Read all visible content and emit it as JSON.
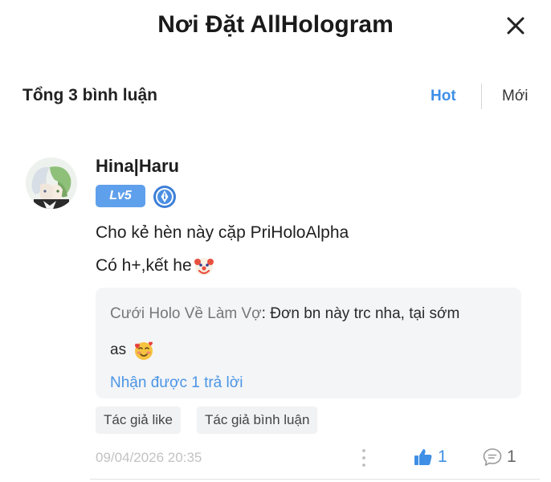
{
  "header": {
    "title": "Nơi Đặt AllHologram",
    "close_icon": "close-icon"
  },
  "comments_bar": {
    "count_label": "Tổng 3 bình luận",
    "sort_hot": "Hot",
    "sort_new": "Mới",
    "active_sort_color": "#3f8fe6"
  },
  "comment": {
    "username": "Hina|Haru",
    "level_badge": "Lv5",
    "level_badge_color": "#5fa0ec",
    "medal_icon": "pen-medal-icon",
    "text_line1": "Cho kẻ hèn này cặp PriHoloAlpha",
    "text_line2": "Có h+,kết he",
    "text_emoji": "clown-face-emoji",
    "reply": {
      "author": "Cưới Holo Về Làm Vợ",
      "separator": ": ",
      "text": "Đơn bn này trc nha, tại sớm",
      "text_cont": "as",
      "emoji": "smiling-face-with-hearts-emoji",
      "more_replies": "Nhận được 1 trả lời"
    },
    "tags": [
      "Tác giả like",
      "Tác giả bình luận"
    ],
    "timestamp": "09/04/2026 20:35",
    "like_count": "1",
    "reply_count": "1"
  }
}
